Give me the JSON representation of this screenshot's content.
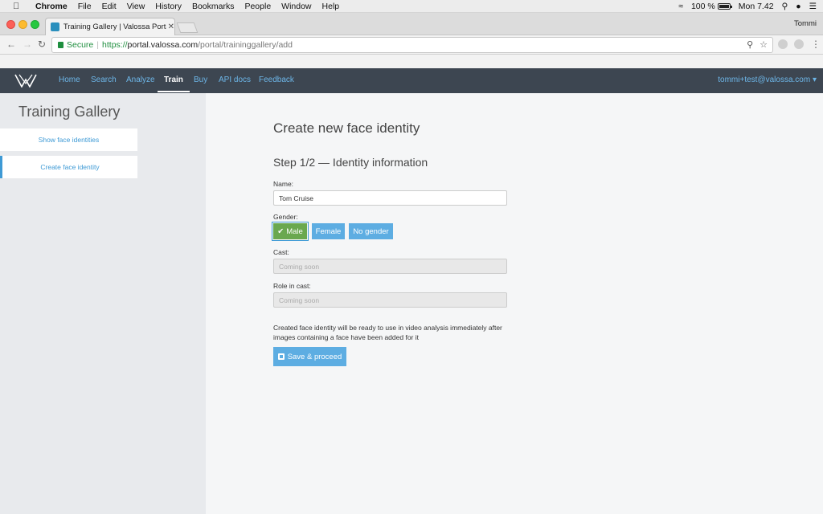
{
  "macos": {
    "menu": [
      "Chrome",
      "File",
      "Edit",
      "View",
      "History",
      "Bookmarks",
      "People",
      "Window",
      "Help"
    ],
    "battery": "100 %",
    "clock": "Mon 7.42"
  },
  "browser": {
    "tab_title": "Training Gallery | Valossa Porta",
    "profile": "Tommi",
    "secure_label": "Secure",
    "url_scheme": "https://",
    "url_host": "portal.valossa.com",
    "url_path": "/portal/traininggallery/add"
  },
  "site_nav": {
    "links": [
      "Home",
      "Search",
      "Analyze",
      "Train",
      "Buy",
      "API docs",
      "Feedback"
    ],
    "active": "Train",
    "user": "tommi+test@valossa.com"
  },
  "sidebar": {
    "title": "Training Gallery",
    "items": [
      {
        "label": "Show face identities"
      },
      {
        "label": "Create face identity"
      }
    ]
  },
  "form": {
    "page_title": "Create new face identity",
    "step_title": "Step 1/2 — Identity information",
    "name_label": "Name:",
    "name_value": "Tom Cruise",
    "gender_label": "Gender:",
    "gender_options": [
      "Male",
      "Female",
      "No gender"
    ],
    "cast_label": "Cast:",
    "cast_placeholder": "Coming soon",
    "role_label": "Role in cast:",
    "role_placeholder": "Coming soon",
    "note": "Created face identity will be ready to use in video analysis immediately after images containing a face have been added for it",
    "save_label": "Save & proceed"
  }
}
